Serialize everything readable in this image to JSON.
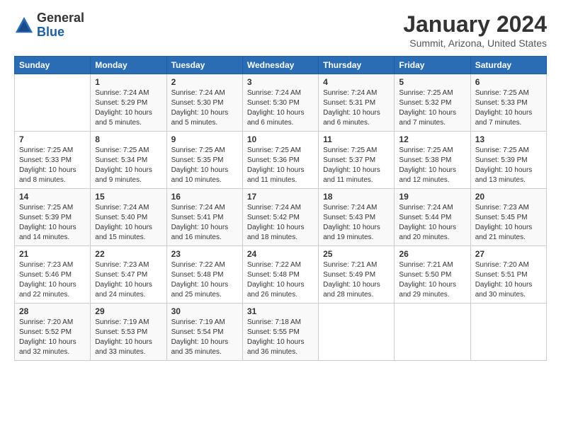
{
  "header": {
    "logo_general": "General",
    "logo_blue": "Blue",
    "month_title": "January 2024",
    "location": "Summit, Arizona, United States"
  },
  "weekdays": [
    "Sunday",
    "Monday",
    "Tuesday",
    "Wednesday",
    "Thursday",
    "Friday",
    "Saturday"
  ],
  "weeks": [
    [
      {
        "day": "",
        "sunrise": "",
        "sunset": "",
        "daylight": ""
      },
      {
        "day": "1",
        "sunrise": "Sunrise: 7:24 AM",
        "sunset": "Sunset: 5:29 PM",
        "daylight": "Daylight: 10 hours and 5 minutes."
      },
      {
        "day": "2",
        "sunrise": "Sunrise: 7:24 AM",
        "sunset": "Sunset: 5:30 PM",
        "daylight": "Daylight: 10 hours and 5 minutes."
      },
      {
        "day": "3",
        "sunrise": "Sunrise: 7:24 AM",
        "sunset": "Sunset: 5:30 PM",
        "daylight": "Daylight: 10 hours and 6 minutes."
      },
      {
        "day": "4",
        "sunrise": "Sunrise: 7:24 AM",
        "sunset": "Sunset: 5:31 PM",
        "daylight": "Daylight: 10 hours and 6 minutes."
      },
      {
        "day": "5",
        "sunrise": "Sunrise: 7:25 AM",
        "sunset": "Sunset: 5:32 PM",
        "daylight": "Daylight: 10 hours and 7 minutes."
      },
      {
        "day": "6",
        "sunrise": "Sunrise: 7:25 AM",
        "sunset": "Sunset: 5:33 PM",
        "daylight": "Daylight: 10 hours and 7 minutes."
      }
    ],
    [
      {
        "day": "7",
        "sunrise": "Sunrise: 7:25 AM",
        "sunset": "Sunset: 5:33 PM",
        "daylight": "Daylight: 10 hours and 8 minutes."
      },
      {
        "day": "8",
        "sunrise": "Sunrise: 7:25 AM",
        "sunset": "Sunset: 5:34 PM",
        "daylight": "Daylight: 10 hours and 9 minutes."
      },
      {
        "day": "9",
        "sunrise": "Sunrise: 7:25 AM",
        "sunset": "Sunset: 5:35 PM",
        "daylight": "Daylight: 10 hours and 10 minutes."
      },
      {
        "day": "10",
        "sunrise": "Sunrise: 7:25 AM",
        "sunset": "Sunset: 5:36 PM",
        "daylight": "Daylight: 10 hours and 11 minutes."
      },
      {
        "day": "11",
        "sunrise": "Sunrise: 7:25 AM",
        "sunset": "Sunset: 5:37 PM",
        "daylight": "Daylight: 10 hours and 11 minutes."
      },
      {
        "day": "12",
        "sunrise": "Sunrise: 7:25 AM",
        "sunset": "Sunset: 5:38 PM",
        "daylight": "Daylight: 10 hours and 12 minutes."
      },
      {
        "day": "13",
        "sunrise": "Sunrise: 7:25 AM",
        "sunset": "Sunset: 5:39 PM",
        "daylight": "Daylight: 10 hours and 13 minutes."
      }
    ],
    [
      {
        "day": "14",
        "sunrise": "Sunrise: 7:25 AM",
        "sunset": "Sunset: 5:39 PM",
        "daylight": "Daylight: 10 hours and 14 minutes."
      },
      {
        "day": "15",
        "sunrise": "Sunrise: 7:24 AM",
        "sunset": "Sunset: 5:40 PM",
        "daylight": "Daylight: 10 hours and 15 minutes."
      },
      {
        "day": "16",
        "sunrise": "Sunrise: 7:24 AM",
        "sunset": "Sunset: 5:41 PM",
        "daylight": "Daylight: 10 hours and 16 minutes."
      },
      {
        "day": "17",
        "sunrise": "Sunrise: 7:24 AM",
        "sunset": "Sunset: 5:42 PM",
        "daylight": "Daylight: 10 hours and 18 minutes."
      },
      {
        "day": "18",
        "sunrise": "Sunrise: 7:24 AM",
        "sunset": "Sunset: 5:43 PM",
        "daylight": "Daylight: 10 hours and 19 minutes."
      },
      {
        "day": "19",
        "sunrise": "Sunrise: 7:24 AM",
        "sunset": "Sunset: 5:44 PM",
        "daylight": "Daylight: 10 hours and 20 minutes."
      },
      {
        "day": "20",
        "sunrise": "Sunrise: 7:23 AM",
        "sunset": "Sunset: 5:45 PM",
        "daylight": "Daylight: 10 hours and 21 minutes."
      }
    ],
    [
      {
        "day": "21",
        "sunrise": "Sunrise: 7:23 AM",
        "sunset": "Sunset: 5:46 PM",
        "daylight": "Daylight: 10 hours and 22 minutes."
      },
      {
        "day": "22",
        "sunrise": "Sunrise: 7:23 AM",
        "sunset": "Sunset: 5:47 PM",
        "daylight": "Daylight: 10 hours and 24 minutes."
      },
      {
        "day": "23",
        "sunrise": "Sunrise: 7:22 AM",
        "sunset": "Sunset: 5:48 PM",
        "daylight": "Daylight: 10 hours and 25 minutes."
      },
      {
        "day": "24",
        "sunrise": "Sunrise: 7:22 AM",
        "sunset": "Sunset: 5:48 PM",
        "daylight": "Daylight: 10 hours and 26 minutes."
      },
      {
        "day": "25",
        "sunrise": "Sunrise: 7:21 AM",
        "sunset": "Sunset: 5:49 PM",
        "daylight": "Daylight: 10 hours and 28 minutes."
      },
      {
        "day": "26",
        "sunrise": "Sunrise: 7:21 AM",
        "sunset": "Sunset: 5:50 PM",
        "daylight": "Daylight: 10 hours and 29 minutes."
      },
      {
        "day": "27",
        "sunrise": "Sunrise: 7:20 AM",
        "sunset": "Sunset: 5:51 PM",
        "daylight": "Daylight: 10 hours and 30 minutes."
      }
    ],
    [
      {
        "day": "28",
        "sunrise": "Sunrise: 7:20 AM",
        "sunset": "Sunset: 5:52 PM",
        "daylight": "Daylight: 10 hours and 32 minutes."
      },
      {
        "day": "29",
        "sunrise": "Sunrise: 7:19 AM",
        "sunset": "Sunset: 5:53 PM",
        "daylight": "Daylight: 10 hours and 33 minutes."
      },
      {
        "day": "30",
        "sunrise": "Sunrise: 7:19 AM",
        "sunset": "Sunset: 5:54 PM",
        "daylight": "Daylight: 10 hours and 35 minutes."
      },
      {
        "day": "31",
        "sunrise": "Sunrise: 7:18 AM",
        "sunset": "Sunset: 5:55 PM",
        "daylight": "Daylight: 10 hours and 36 minutes."
      },
      {
        "day": "",
        "sunrise": "",
        "sunset": "",
        "daylight": ""
      },
      {
        "day": "",
        "sunrise": "",
        "sunset": "",
        "daylight": ""
      },
      {
        "day": "",
        "sunrise": "",
        "sunset": "",
        "daylight": ""
      }
    ]
  ]
}
